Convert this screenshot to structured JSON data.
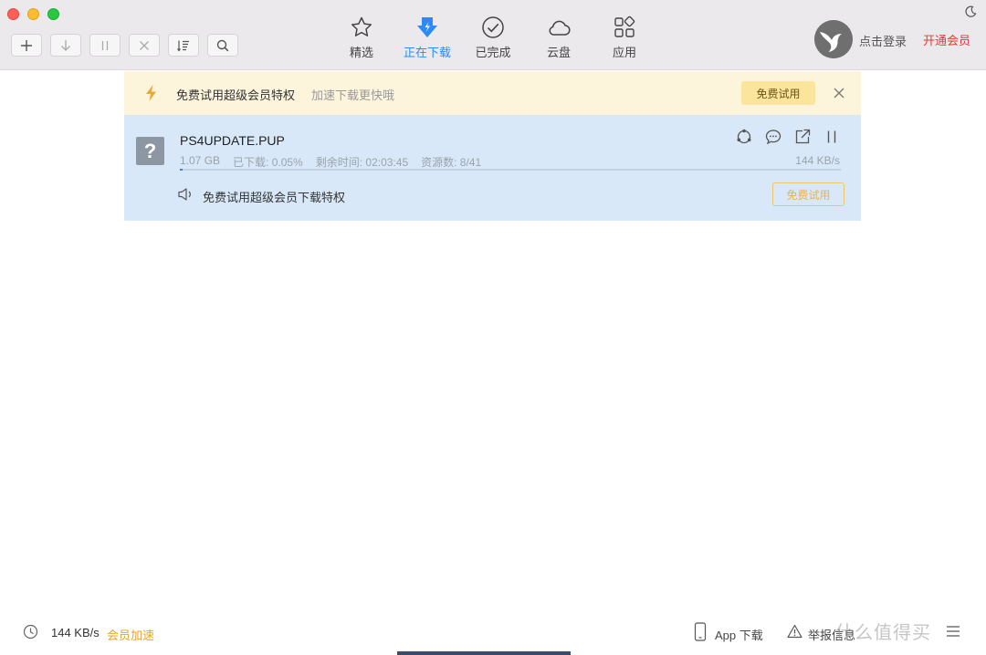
{
  "toolbar": {
    "nav_tabs": [
      {
        "label": "精选",
        "icon": "star-icon"
      },
      {
        "label": "正在下载",
        "icon": "download-bolt-icon",
        "active": true
      },
      {
        "label": "已完成",
        "icon": "check-circle-icon"
      },
      {
        "label": "云盘",
        "icon": "cloud-icon"
      },
      {
        "label": "应用",
        "icon": "apps-grid-icon"
      }
    ],
    "login_text": "点击登录",
    "vip_link": "开通会员"
  },
  "promo": {
    "title": "免费试用超级会员特权",
    "subtitle": "加速下载更快哦",
    "try_label": "免费试用"
  },
  "download": {
    "file_name": "PS4UPDATE.PUP",
    "size": "1.07 GB",
    "downloaded": "已下载: 0.05%",
    "remaining": "剩余时间: 02:03:45",
    "sources": "资源数: 8/41",
    "speed": "144 KB/s",
    "progress_percent": 0.05,
    "promo_text": "免费试用超级会员下载特权",
    "try_label": "免费试用"
  },
  "statusbar": {
    "speed": "144 KB/s",
    "boost": "会员加速",
    "app_download": "App 下载",
    "report": "举报信息"
  },
  "watermark": "什么值得买",
  "colors": {
    "accent": "#2a8af6",
    "vip_red": "#e23b2e",
    "gold": "#e6a429",
    "banner_bg": "#fdf4dc",
    "item_bg": "#d8e8f8"
  }
}
